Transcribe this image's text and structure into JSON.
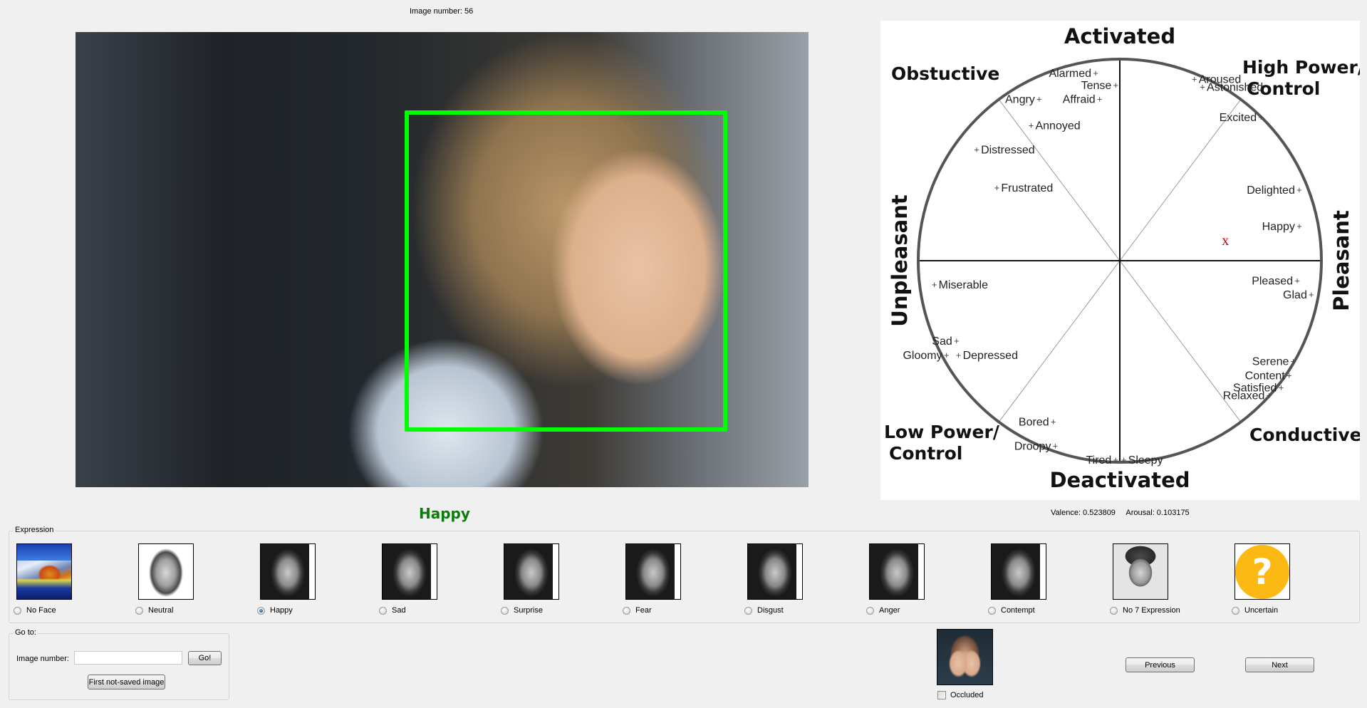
{
  "header": {
    "image_number_label": "Image number: 56"
  },
  "main_image": {
    "description": "Photo of a smiling woman with a green face detection box",
    "face_box_color": "#00ff00"
  },
  "prediction": {
    "label": "Happy",
    "color": "#0a7d0a",
    "valence_text": "Valence: 0.523809",
    "arousal_text": "Arousal: 0.103175",
    "valence": 0.523809,
    "arousal": 0.103175
  },
  "emotion_wheel": {
    "axis_labels": {
      "top": "Activated",
      "bottom": "Deactivated",
      "left": "Unpleasant",
      "right": "Pleasant"
    },
    "corner_labels": {
      "top_left": "Obstuctive",
      "top_right_line1": "High Power/",
      "top_right_line2": "Control",
      "bottom_left_line1": "Low Power/",
      "bottom_left_line2": "Control",
      "bottom_right": "Conductive"
    },
    "marker": {
      "symbol": "x",
      "color": "#cc0000"
    },
    "emotions": [
      {
        "label": "Alarmed",
        "v": -0.12,
        "a": 0.93,
        "anchor": "end"
      },
      {
        "label": "Tense",
        "v": -0.02,
        "a": 0.87,
        "anchor": "end"
      },
      {
        "label": "Affraid",
        "v": -0.1,
        "a": 0.8,
        "anchor": "end"
      },
      {
        "label": "Angry",
        "v": -0.4,
        "a": 0.8,
        "anchor": "end"
      },
      {
        "label": "Annoyed",
        "v": -0.44,
        "a": 0.67,
        "anchor": "start"
      },
      {
        "label": "Distressed",
        "v": -0.71,
        "a": 0.55,
        "anchor": "start"
      },
      {
        "label": "Frustrated",
        "v": -0.61,
        "a": 0.36,
        "anchor": "start"
      },
      {
        "label": "Aroused",
        "v": 0.37,
        "a": 0.9,
        "anchor": "start"
      },
      {
        "label": "Astonished",
        "v": 0.41,
        "a": 0.86,
        "anchor": "start"
      },
      {
        "label": "Excited",
        "v": 0.7,
        "a": 0.71,
        "anchor": "end"
      },
      {
        "label": "Delighted",
        "v": 0.89,
        "a": 0.35,
        "anchor": "end"
      },
      {
        "label": "Happy",
        "v": 0.89,
        "a": 0.17,
        "anchor": "end"
      },
      {
        "label": "Pleased",
        "v": 0.88,
        "a": -0.1,
        "anchor": "end"
      },
      {
        "label": "Glad",
        "v": 0.95,
        "a": -0.17,
        "anchor": "end"
      },
      {
        "label": "Serene",
        "v": 0.86,
        "a": -0.5,
        "anchor": "end"
      },
      {
        "label": "Content",
        "v": 0.84,
        "a": -0.57,
        "anchor": "end"
      },
      {
        "label": "Satisfied",
        "v": 0.8,
        "a": -0.63,
        "anchor": "end"
      },
      {
        "label": "Relaxed",
        "v": 0.74,
        "a": -0.67,
        "anchor": "end"
      },
      {
        "label": "Miserable",
        "v": -0.92,
        "a": -0.12,
        "anchor": "start"
      },
      {
        "label": "Sad",
        "v": -0.81,
        "a": -0.4,
        "anchor": "end"
      },
      {
        "label": "Gloomy",
        "v": -0.86,
        "a": -0.47,
        "anchor": "end"
      },
      {
        "label": "Depressed",
        "v": -0.8,
        "a": -0.47,
        "anchor": "start"
      },
      {
        "label": "Bored",
        "v": -0.33,
        "a": -0.8,
        "anchor": "end"
      },
      {
        "label": "Droopy",
        "v": -0.32,
        "a": -0.92,
        "anchor": "end"
      },
      {
        "label": "Tired",
        "v": -0.02,
        "a": -0.99,
        "anchor": "end"
      },
      {
        "label": "Sleepy",
        "v": 0.02,
        "a": -0.99,
        "anchor": "start"
      }
    ]
  },
  "expression_group": {
    "title": "Expression",
    "selected": "Happy",
    "options": [
      {
        "label": "No Face",
        "thumb": "landscape-image",
        "checked": false
      },
      {
        "label": "Neutral",
        "thumb": "neutral-face-image",
        "checked": false
      },
      {
        "label": "Happy",
        "thumb": "happy-face-image",
        "checked": true
      },
      {
        "label": "Sad",
        "thumb": "sad-face-image",
        "checked": false
      },
      {
        "label": "Surprise",
        "thumb": "surprise-face-image",
        "checked": false
      },
      {
        "label": "Fear",
        "thumb": "fear-face-image",
        "checked": false
      },
      {
        "label": "Disgust",
        "thumb": "disgust-face-image",
        "checked": false
      },
      {
        "label": "Anger",
        "thumb": "anger-face-image",
        "checked": false
      },
      {
        "label": "Contempt",
        "thumb": "contempt-face-image",
        "checked": false
      },
      {
        "label": "No 7 Expression",
        "thumb": "other-expression-image",
        "checked": false
      },
      {
        "label": "Uncertain",
        "thumb": "question-mark-icon",
        "checked": false,
        "glyph": "?"
      }
    ]
  },
  "goto_group": {
    "title": "Go to:",
    "image_number_label": "Image number:",
    "image_number_value": "",
    "image_number_placeholder": "",
    "go_button": "Go!",
    "first_not_saved_button": "First not-saved image"
  },
  "occluded": {
    "label": "Occluded",
    "checked": false
  },
  "navigation": {
    "previous_button": "Previous",
    "next_button": "Next"
  }
}
